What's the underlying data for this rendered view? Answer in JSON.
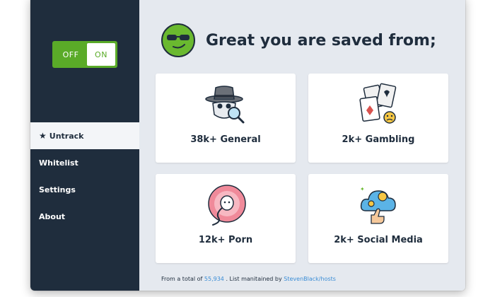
{
  "toggle": {
    "off_label": "OFF",
    "on_label": "ON",
    "state": "ON"
  },
  "nav": {
    "items": [
      {
        "label": "Untrack",
        "icon": "star-icon",
        "active": true
      },
      {
        "label": "Whitelist"
      },
      {
        "label": "Settings"
      },
      {
        "label": "About"
      }
    ]
  },
  "header": {
    "title": "Great you are saved from;",
    "logo_icon": "sunglasses-face-icon"
  },
  "cards": [
    {
      "label": "38k+ General",
      "icon": "spy-icon"
    },
    {
      "label": "2k+ Gambling",
      "icon": "playing-cards-icon"
    },
    {
      "label": "12k+ Porn",
      "icon": "sperm-egg-icon"
    },
    {
      "label": "2k+ Social Media",
      "icon": "social-cloud-icon"
    }
  ],
  "footer": {
    "prefix": "From a total of",
    "total": "55,934",
    "middle": ". List manitained by",
    "source": "StevenBlack/hosts"
  },
  "colors": {
    "sidebar": "#1f2d3d",
    "toggle_green": "#5aab28",
    "main_bg": "#e5e9ef",
    "link": "#3a8dd6"
  }
}
